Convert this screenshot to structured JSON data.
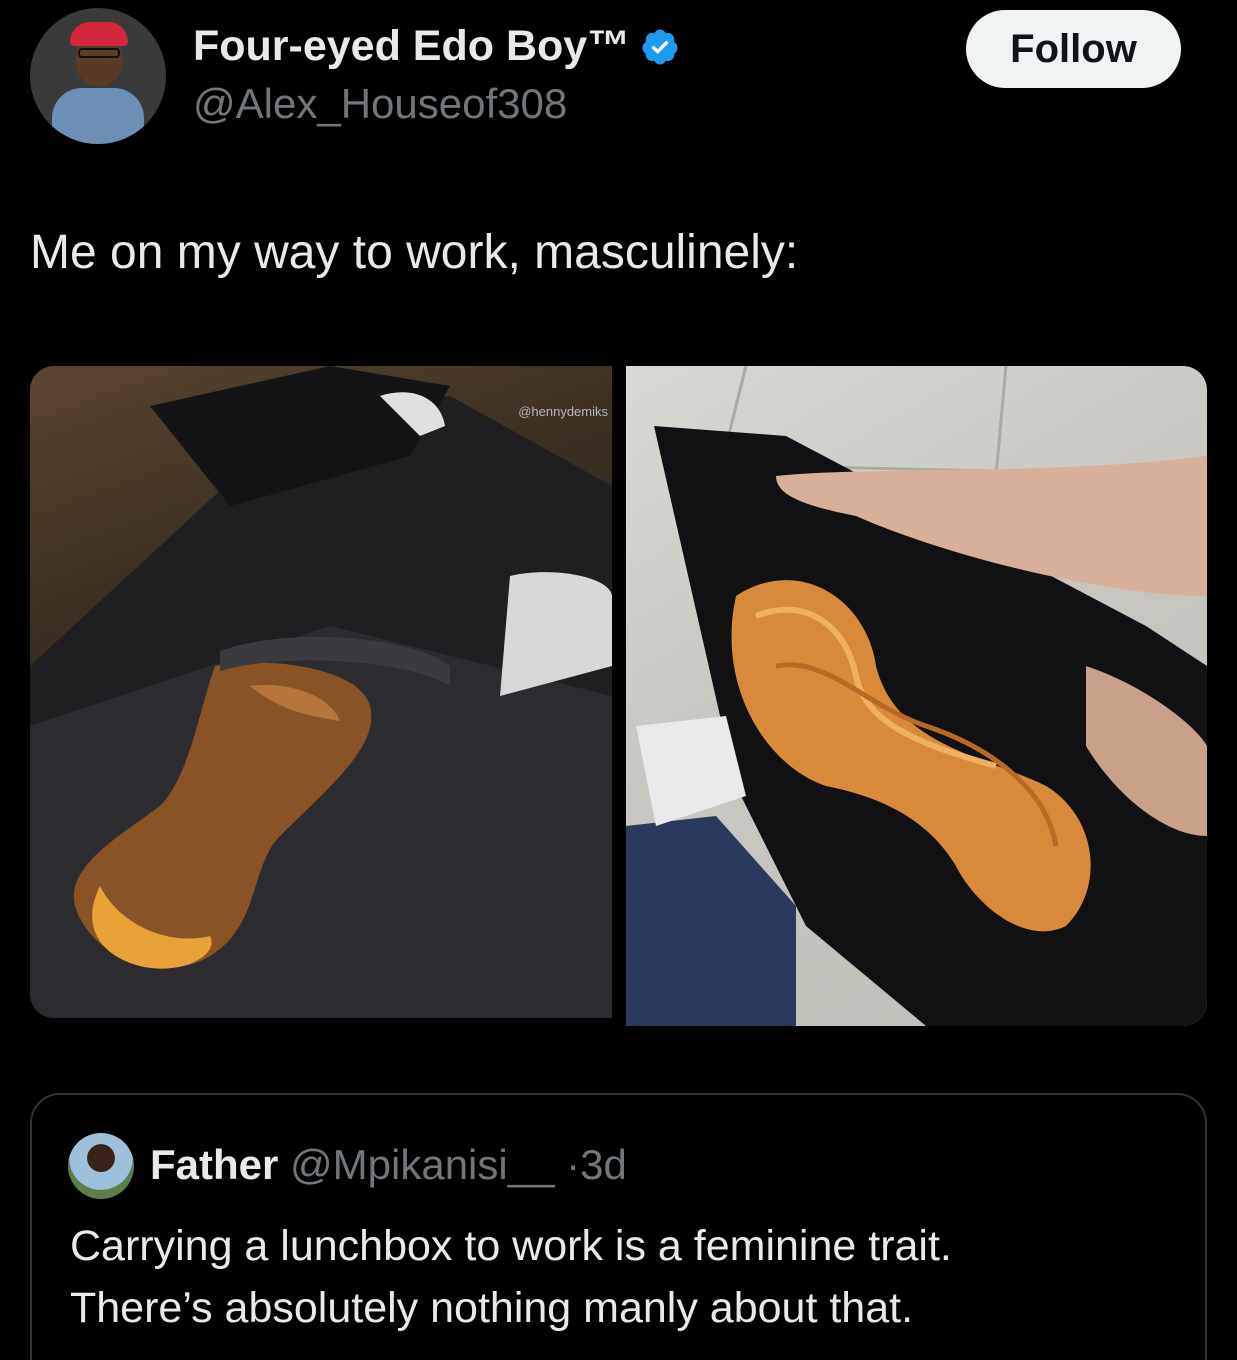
{
  "author": {
    "display_name": "Four-eyed Edo Boy™",
    "handle": "@Alex_Houseof308",
    "verified": true
  },
  "follow_label": "Follow",
  "tweet": {
    "text": "Me on my way to work, masculinely:"
  },
  "media": {
    "left_watermark": "@hennydemiks"
  },
  "quoted_tweet": {
    "display_name": "Father",
    "handle": "@Mpikanisi__",
    "separator": "·",
    "age": "3d",
    "text_line1": "Carrying a lunchbox to work is a feminine trait.",
    "text_line2": "There’s absolutely nothing manly about that."
  },
  "colors": {
    "background": "#000000",
    "text_primary": "#e7e9ea",
    "text_secondary": "#71767b",
    "verified_badge": "#1d9bf0",
    "border": "#2f3336"
  }
}
